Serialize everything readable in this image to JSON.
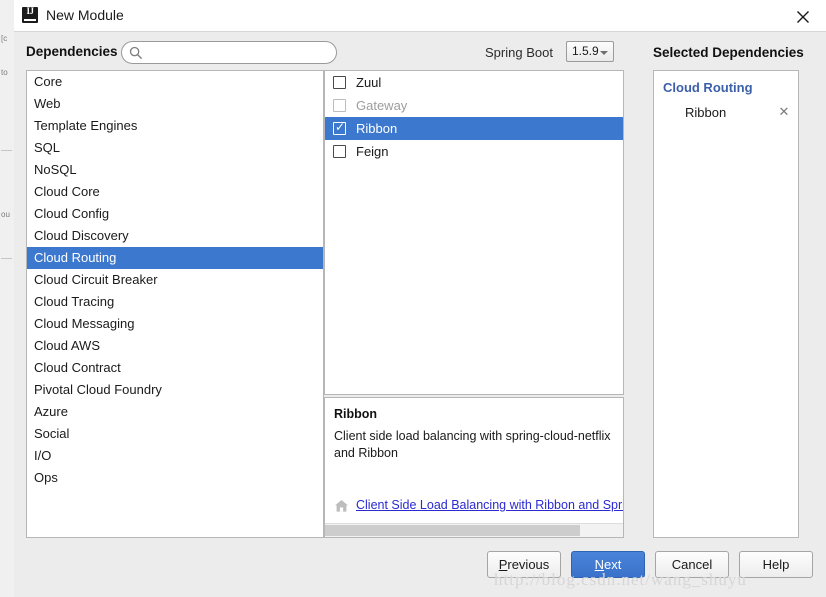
{
  "window": {
    "title": "New Module",
    "app_icon": "intellij-idea-icon",
    "close_icon": "close-icon"
  },
  "header": {
    "dependencies_label": "Dependencies",
    "search": {
      "icon": "search-icon",
      "value": "",
      "placeholder": ""
    },
    "spring_boot_label": "Spring Boot",
    "spring_boot_version": "1.5.9",
    "version_dropdown_icon": "chevron-down-icon",
    "selected_dependencies_label": "Selected Dependencies"
  },
  "categories": {
    "selected_index": 8,
    "items": [
      {
        "label": "Core"
      },
      {
        "label": "Web"
      },
      {
        "label": "Template Engines"
      },
      {
        "label": "SQL"
      },
      {
        "label": "NoSQL"
      },
      {
        "label": "Cloud Core"
      },
      {
        "label": "Cloud Config"
      },
      {
        "label": "Cloud Discovery"
      },
      {
        "label": "Cloud Routing"
      },
      {
        "label": "Cloud Circuit Breaker"
      },
      {
        "label": "Cloud Tracing"
      },
      {
        "label": "Cloud Messaging"
      },
      {
        "label": "Cloud AWS"
      },
      {
        "label": "Cloud Contract"
      },
      {
        "label": "Pivotal Cloud Foundry"
      },
      {
        "label": "Azure"
      },
      {
        "label": "Social"
      },
      {
        "label": "I/O"
      },
      {
        "label": "Ops"
      }
    ]
  },
  "dependencies": {
    "items": [
      {
        "label": "Zuul",
        "checked": false,
        "disabled": false,
        "selected": false
      },
      {
        "label": "Gateway",
        "checked": false,
        "disabled": true,
        "selected": false
      },
      {
        "label": "Ribbon",
        "checked": true,
        "disabled": false,
        "selected": true
      },
      {
        "label": "Feign",
        "checked": false,
        "disabled": false,
        "selected": false
      }
    ]
  },
  "description": {
    "title": "Ribbon",
    "body": "Client side load balancing with spring-cloud-netflix and Ribbon",
    "link_icon": "home-icon",
    "link_text": "Client Side Load Balancing with Ribbon and Spring",
    "scrollbar": "horizontal-scrollbar"
  },
  "selected_dependencies": {
    "group_label": "Cloud Routing",
    "group_color": "#3b5fa8",
    "items": [
      {
        "label": "Ribbon",
        "remove_icon": "close-icon"
      }
    ]
  },
  "buttons": {
    "previous": {
      "pre": "",
      "mnemonic": "P",
      "post": "revious"
    },
    "next": {
      "pre": "",
      "mnemonic": "N",
      "post": "ext"
    },
    "cancel": {
      "label": "Cancel"
    },
    "help": {
      "label": "Help"
    }
  },
  "watermark": {
    "text": "http://blog.csdn.net/wang_shuyu"
  },
  "colors": {
    "selection_blue": "#3d78cf",
    "primary_button": "#3a72cb",
    "link_blue": "#2a2ad0",
    "group_blue": "#3b5fa8",
    "window_bg": "#ececec",
    "panel_bg": "#ffffff"
  }
}
